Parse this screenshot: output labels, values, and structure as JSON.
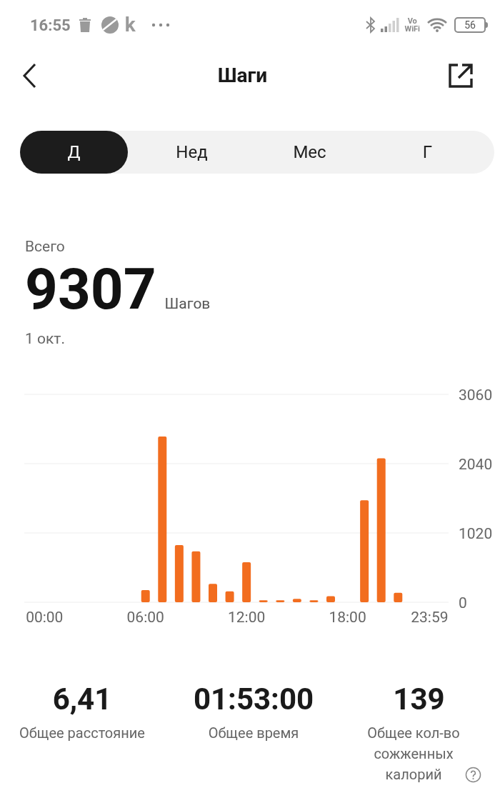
{
  "status_bar": {
    "time": "16:55",
    "app_letter": "k",
    "volte": [
      "Vo",
      "WiFi"
    ],
    "battery": "56"
  },
  "header": {
    "title": "Шаги"
  },
  "tabs": [
    {
      "label": "Д",
      "selected": true
    },
    {
      "label": "Нед",
      "selected": false
    },
    {
      "label": "Мес",
      "selected": false
    },
    {
      "label": "Г",
      "selected": false
    }
  ],
  "summary": {
    "label": "Всего",
    "value": "9307",
    "unit": "Шагов",
    "date": "1 окт."
  },
  "chart_data": {
    "type": "bar",
    "x": [
      6,
      7,
      8,
      9,
      10,
      11,
      12,
      13,
      14,
      15,
      16,
      17,
      19,
      20,
      21
    ],
    "series": [
      {
        "color": "#f26d1f",
        "values": [
          180,
          2440,
          840,
          750,
          270,
          160,
          590,
          30,
          30,
          50,
          30,
          90,
          1500,
          2120,
          140
        ]
      }
    ],
    "xlim": [
      -1.2,
      24
    ],
    "ylim": [
      0,
      3060
    ],
    "yticks": [
      0,
      1020,
      2040,
      3060
    ],
    "xticks": [
      {
        "value": 0,
        "label": "00:00"
      },
      {
        "value": 6,
        "label": "06:00"
      },
      {
        "value": 12,
        "label": "12:00"
      },
      {
        "value": 18,
        "label": "18:00"
      },
      {
        "value": 23.98,
        "label": "23:59"
      }
    ]
  },
  "stats": [
    {
      "value": "6,41",
      "label": "Общее расстояние",
      "help": false
    },
    {
      "value": "01:53:00",
      "label": "Общее время",
      "help": false
    },
    {
      "value": "139",
      "label": "Общее кол-во сожженных калорий",
      "help": true
    }
  ]
}
